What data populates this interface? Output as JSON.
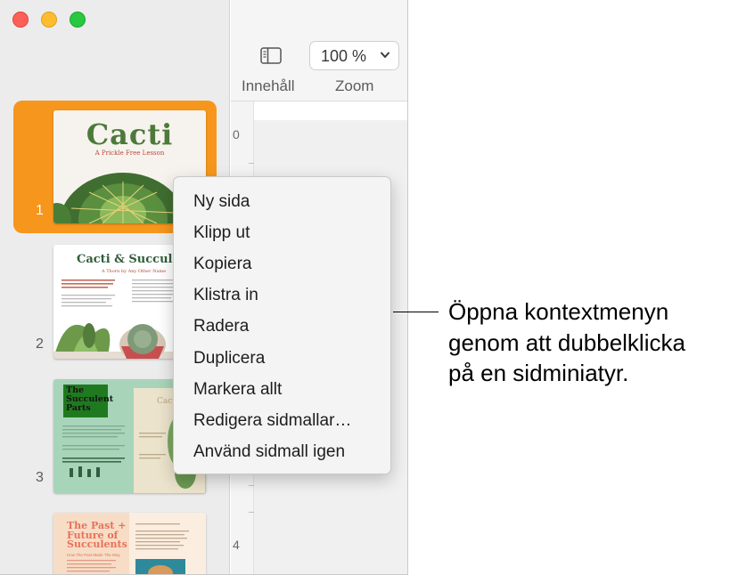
{
  "window": {
    "controls": [
      "close-button",
      "minimize-button",
      "zoom-window-button"
    ]
  },
  "toolbar": {
    "content_label": "Innehåll",
    "zoom_label": "Zoom",
    "zoom_value": "100 %"
  },
  "ruler": {
    "marks": [
      "0",
      "4"
    ]
  },
  "pages": [
    {
      "number": "1",
      "title": "Cacti",
      "subtitle": "A Prickle Free Lesson",
      "selected": true
    },
    {
      "number": "2",
      "title": "Cacti & Succulen",
      "subtitle": "A Thorn by Any Other Name"
    },
    {
      "number": "3",
      "title_lines": [
        "The",
        "Succulent",
        "Parts"
      ],
      "side_title": "Cact Succ",
      "side_title_2": "Succ"
    },
    {
      "number": "",
      "title_lines": [
        "The Past +",
        "Future of",
        "Succulents"
      ],
      "subheading": "How The Past Made The Way"
    }
  ],
  "context_menu": {
    "items": [
      "Ny sida",
      "Klipp ut",
      "Kopiera",
      "Klistra in",
      "Radera",
      "Duplicera",
      "Markera allt",
      "Redigera sidmallar…",
      "Använd sidmall igen"
    ]
  },
  "callout": {
    "lines": [
      "Öppna kontextmenyn",
      "genom att dubbelklicka",
      "på en sidminiatyr."
    ]
  },
  "colors": {
    "selection": "#f7961c",
    "cactus_green": "#4d7a3a",
    "succulent_bg": "#a8d5b9",
    "coral": "#e8715a"
  }
}
